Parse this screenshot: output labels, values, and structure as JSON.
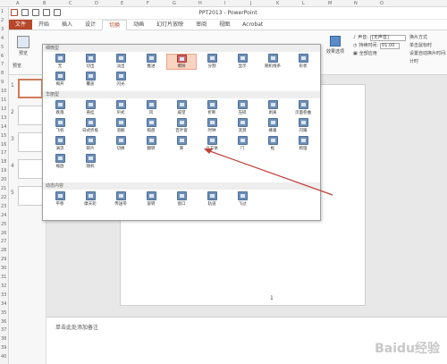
{
  "app": {
    "title": "PPT2013 - PowerPoint",
    "tabs": [
      "文件",
      "开始",
      "插入",
      "设计",
      "切换",
      "动画",
      "幻灯片放映",
      "审阅",
      "视图",
      "Acrobat"
    ],
    "active_tab": "切换"
  },
  "sheet": {
    "columns": [
      "A",
      "B",
      "C",
      "D",
      "E",
      "F",
      "G",
      "H",
      "I",
      "J",
      "K",
      "L",
      "M",
      "N",
      "O"
    ],
    "rows": [
      "1",
      "2",
      "3",
      "4",
      "5",
      "6",
      "7",
      "8",
      "9",
      "10",
      "11",
      "12",
      "13",
      "14",
      "15",
      "16",
      "17",
      "18",
      "19",
      "20",
      "21",
      "22",
      "23",
      "24",
      "25",
      "26",
      "27",
      "28",
      "29",
      "30",
      "31",
      "32",
      "33",
      "34",
      "35",
      "36",
      "37",
      "38",
      "39",
      "40"
    ]
  },
  "ribbon": {
    "preview_label": "预览",
    "preview_group": "预览",
    "effect_options": "效果选项",
    "sound_label": "声音:",
    "sound_value": "[无声音]",
    "duration_label": "持续时间:",
    "duration_value": "01.00",
    "apply_all": "全部应用",
    "advance_label": "换片方式",
    "on_click": "单击鼠标时",
    "after_label": "设置自动换片时间:",
    "timing_group": "计时"
  },
  "gallery": {
    "sections": [
      {
        "title": "细微型",
        "items": [
          "无",
          "切出",
          "淡出",
          "推进",
          "擦除",
          "分割",
          "显示",
          "随机线条",
          "形状",
          "揭开",
          "覆盖",
          "闪光"
        ]
      },
      {
        "title": "华丽型",
        "items": [
          "跌落",
          "悬挂",
          "帘式",
          "风",
          "威望",
          "折断",
          "压碎",
          "剥离",
          "页面卷曲",
          "飞机",
          "日式折纸",
          "溶解",
          "棋盘",
          "百叶窗",
          "时钟",
          "涟漪",
          "蜂巢",
          "闪耀",
          "涡流",
          "碎片",
          "切换",
          "翻转",
          "库",
          "立方体",
          "门",
          "框",
          "梳理",
          "缩放",
          "随机"
        ]
      },
      {
        "title": "动态内容",
        "items": [
          "平移",
          "摩天轮",
          "传送带",
          "旋转",
          "窗口",
          "轨道",
          "飞过"
        ]
      }
    ],
    "highlighted": "擦除",
    "pointed": "立方体"
  },
  "slides": {
    "thumb_numbers": [
      "1",
      "2",
      "3",
      "4",
      "5"
    ],
    "slide_number": "1"
  },
  "notes": {
    "placeholder": "单击此处添加备注"
  },
  "watermark": "Baidu经验"
}
